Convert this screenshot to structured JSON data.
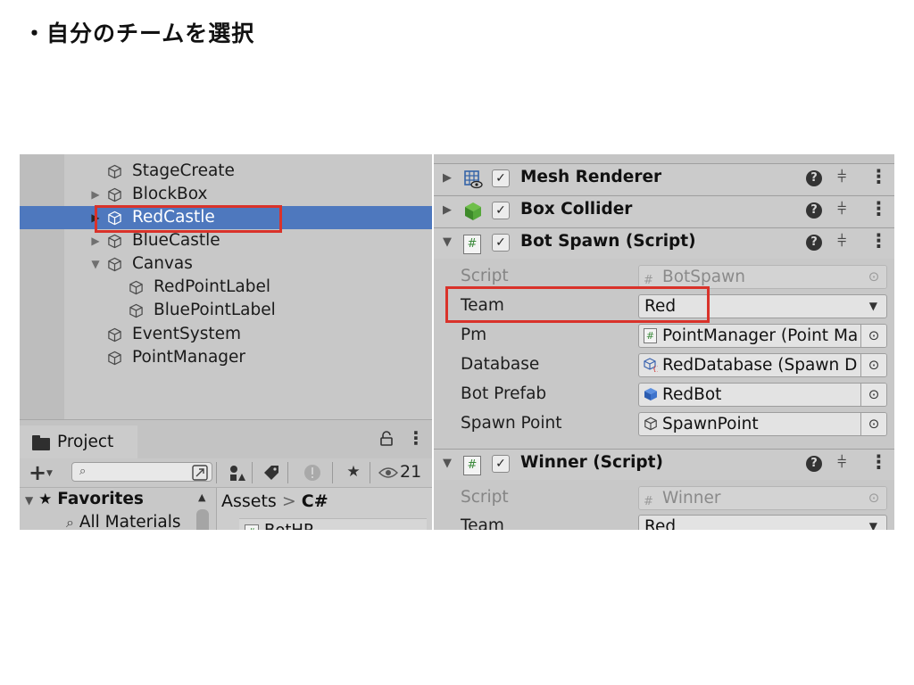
{
  "slide": {
    "title": "・自分のチームを選択"
  },
  "hierarchy": {
    "items": [
      {
        "label": "StageCreate",
        "expander": "",
        "indent": 0,
        "selected": false
      },
      {
        "label": "BlockBox",
        "expander": "▶",
        "indent": 0,
        "selected": false
      },
      {
        "label": "RedCastle",
        "expander": "▶",
        "indent": 0,
        "selected": true
      },
      {
        "label": "BlueCastle",
        "expander": "▶",
        "indent": 0,
        "selected": false
      },
      {
        "label": "Canvas",
        "expander": "▼",
        "indent": 0,
        "selected": false
      },
      {
        "label": "RedPointLabel",
        "expander": "",
        "indent": 1,
        "selected": false
      },
      {
        "label": "BluePointLabel",
        "expander": "",
        "indent": 1,
        "selected": false
      },
      {
        "label": "EventSystem",
        "expander": "",
        "indent": 0,
        "selected": false
      },
      {
        "label": "PointManager",
        "expander": "",
        "indent": 0,
        "selected": false
      }
    ]
  },
  "project": {
    "tab_label": "Project",
    "lock_icon": "lock-icon",
    "more_icon": "⋮",
    "add_label": "+",
    "search_placeholder": "",
    "visible_count": "21",
    "favorites_label": "Favorites",
    "favorites_item": "All Materials",
    "breadcrumb": [
      "Assets",
      "C#"
    ],
    "asset_item": "BotHP"
  },
  "inspector": {
    "components": [
      {
        "title": "Mesh Renderer",
        "expanded": false,
        "enabled": true,
        "icon": "mesh-renderer-icon"
      },
      {
        "title": "Box Collider",
        "expanded": false,
        "enabled": true,
        "icon": "box-collider-icon"
      },
      {
        "title": "Bot Spawn (Script)",
        "expanded": true,
        "enabled": true,
        "icon": "script-icon"
      },
      {
        "title": "Winner (Script)",
        "expanded": true,
        "enabled": true,
        "icon": "script-icon"
      }
    ],
    "bot_spawn_props": [
      {
        "label": "Script",
        "value": "BotSpawn",
        "kind": "script",
        "dim": true
      },
      {
        "label": "Team",
        "value": "Red",
        "kind": "enum",
        "dim": false
      },
      {
        "label": "Pm",
        "value": "PointManager (Point Ma",
        "kind": "object-script",
        "dim": false
      },
      {
        "label": "Database",
        "value": "RedDatabase (Spawn D",
        "kind": "object-asset",
        "dim": false
      },
      {
        "label": "Bot Prefab",
        "value": "RedBot",
        "kind": "object-prefab",
        "dim": false
      },
      {
        "label": "Spawn Point",
        "value": "SpawnPoint",
        "kind": "object-gameobject",
        "dim": false
      }
    ],
    "winner_props": [
      {
        "label": "Script",
        "value": "Winner",
        "kind": "script",
        "dim": true
      },
      {
        "label": "Team",
        "value": "Red",
        "kind": "enum",
        "dim": false
      }
    ]
  },
  "colors": {
    "highlight": "#d9322a",
    "selection": "#4e78be"
  }
}
